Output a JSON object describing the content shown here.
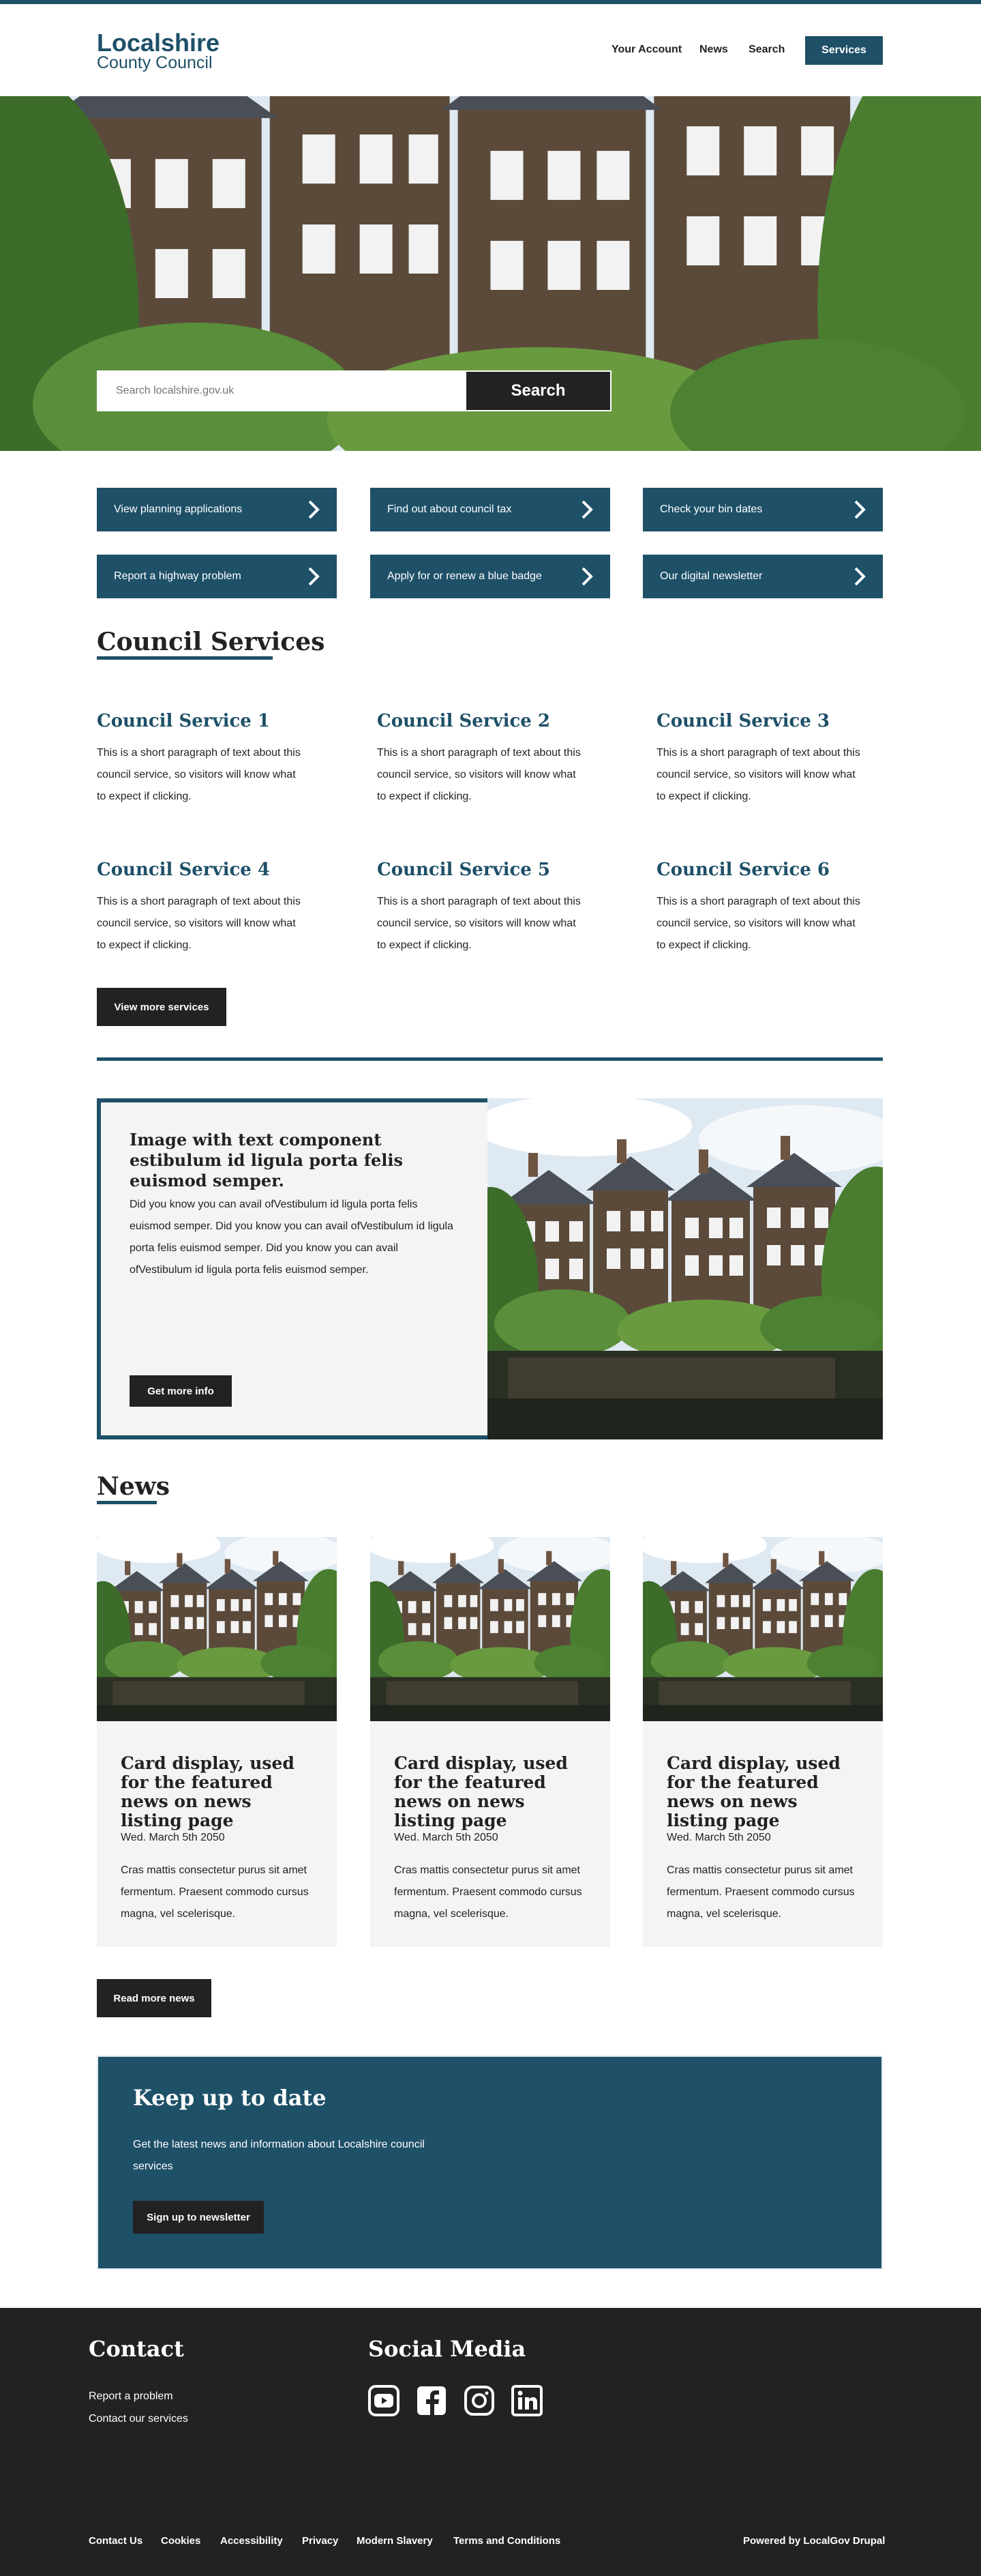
{
  "brand": {
    "line1": "Localshire",
    "line2": "County Council",
    "accent": "#1e5068",
    "dark": "#222222"
  },
  "nav": {
    "account": "Your Account",
    "news": "News",
    "search": "Search",
    "services": "Services"
  },
  "hero": {
    "search_placeholder": "Search localshire.gov.uk",
    "search_button": "Search"
  },
  "quick_links": [
    "View planning applications",
    "Find out about council tax",
    "Check your bin dates",
    "Report a highway problem",
    "Apply for or renew a blue badge",
    "Our digital newsletter"
  ],
  "services": {
    "heading": "Council Services",
    "items": [
      {
        "title": "Council Service 1",
        "text": "This is a short paragraph of text about this council service, so visitors will know what to expect if clicking."
      },
      {
        "title": "Council Service 2",
        "text": "This is a short paragraph of text about this council service, so visitors will know what to expect if clicking."
      },
      {
        "title": "Council Service 3",
        "text": "This is a short paragraph of text about this council service, so visitors will know what to expect if clicking."
      },
      {
        "title": "Council Service 4",
        "text": "This is a short paragraph of text about this council service, so visitors will know what to expect if clicking."
      },
      {
        "title": "Council Service 5",
        "text": "This is a short paragraph of text about this council service, so visitors will know what to expect if clicking."
      },
      {
        "title": "Council Service 6",
        "text": "This is a short paragraph of text about this council service, so visitors will know what to expect if clicking."
      }
    ],
    "more_button": "View more services"
  },
  "feature": {
    "title": "Image with text component estibulum id ligula porta felis euismod semper.",
    "text": "Did you know you can avail ofVestibulum id ligula porta felis euismod semper. Did you know you can avail ofVestibulum id ligula porta felis euismod semper. Did you know you can avail ofVestibulum id ligula porta felis euismod semper.",
    "button": "Get more info"
  },
  "news": {
    "heading": "News",
    "cards": [
      {
        "title": "Card display, used for the featured news on news listing page",
        "date": "Wed. March 5th 2050",
        "text": "Cras mattis consectetur purus sit amet fermentum. Praesent commodo cursus magna, vel scelerisque."
      },
      {
        "title": "Card display, used for the featured news on news listing page",
        "date": "Wed. March 5th 2050",
        "text": "Cras mattis consectetur purus sit amet fermentum. Praesent commodo cursus magna, vel scelerisque."
      },
      {
        "title": "Card display, used for the featured news on news listing page",
        "date": "Wed. March 5th 2050",
        "text": "Cras mattis consectetur purus sit amet fermentum. Praesent commodo cursus magna, vel scelerisque."
      }
    ],
    "more_button": "Read more news"
  },
  "newsletter": {
    "title": "Keep up to date",
    "text": "Get the latest news and information about Localshire council services",
    "button": "Sign up to newsletter"
  },
  "footer": {
    "contact_heading": "Contact",
    "contact_links": [
      "Report a problem",
      "Contact our services"
    ],
    "social_heading": "Social Media",
    "social_icons": [
      "youtube-icon",
      "facebook-icon",
      "instagram-icon",
      "linkedin-icon"
    ],
    "bottom_links": [
      "Contact Us",
      "Cookies",
      "Accessibility",
      "Privacy",
      "Modern Slavery",
      "Terms and Conditions"
    ],
    "powered_by": "Powered by LocalGov Drupal"
  }
}
